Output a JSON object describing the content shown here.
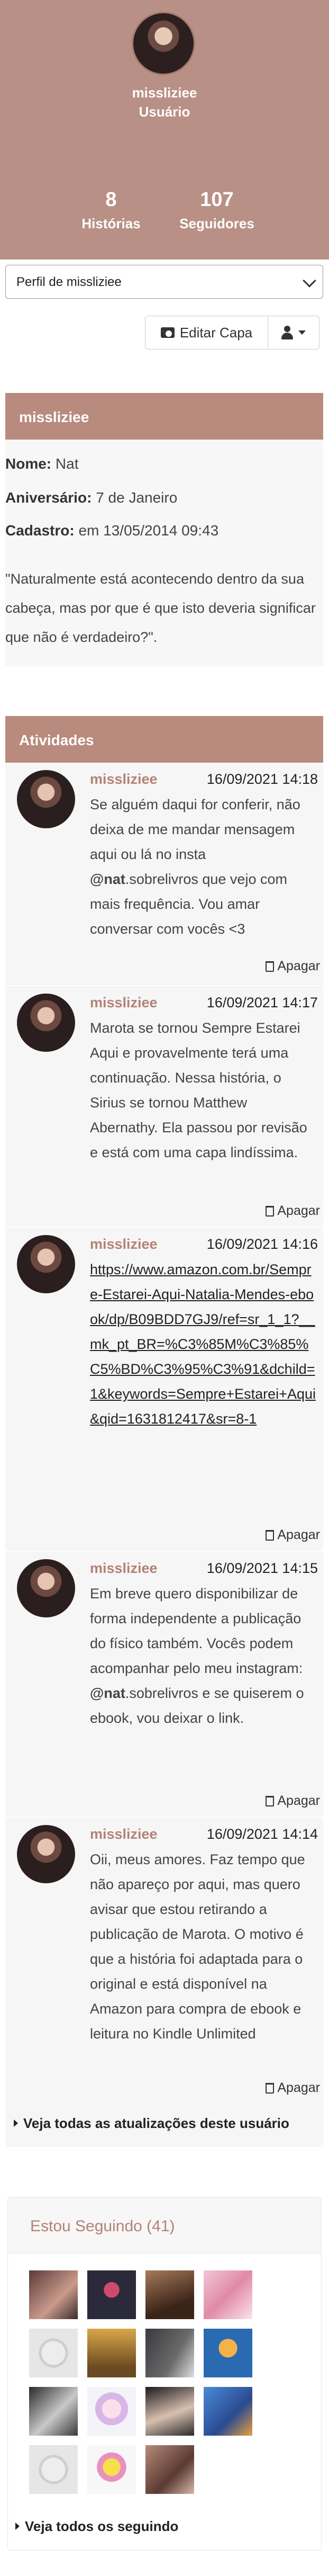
{
  "profile": {
    "username": "missliziee",
    "role": "Usuário",
    "stats": [
      {
        "value": "8",
        "label": "Histórias"
      },
      {
        "value": "107",
        "label": "Seguidores"
      }
    ],
    "profile_select": "Perfil de missliziee",
    "edit_cover": "Editar Capa"
  },
  "about": {
    "title": "missliziee",
    "name_label": "Nome:",
    "name_value": "Nat",
    "birthday_label": "Aniversário:",
    "birthday_value": "7 de Janeiro",
    "signup_label": "Cadastro:",
    "signup_value": "em 13/05/2014 09:43",
    "bio": "\"Naturalmente está acontecendo dentro da sua cabeça, mas por que é que isto deveria significar que não é verdadeiro?\"."
  },
  "activities": {
    "title": "Atividades",
    "delete_label": "Apagar",
    "items": [
      {
        "user": "missliziee",
        "time": "16/09/2021 14:18",
        "pre": "Se alguém daqui for conferir, não deixa de me mandar mensagem aqui ou lá no insta ",
        "mention": "@nat",
        "post": ".sobrelivros que vejo com mais frequência. Vou amar conversar com vocês <3"
      },
      {
        "user": "missliziee",
        "time": "16/09/2021 14:17",
        "text": "Marota se tornou Sempre Estarei Aqui e provavelmente terá uma continuação. Nessa história, o Sirius se tornou Matthew Abernathy. Ela passou por revisão e está com uma capa lindíssima."
      },
      {
        "user": "missliziee",
        "time": "16/09/2021 14:16",
        "link": "https://www.amazon.com.br/Sempre-Estarei-Aqui-Natalia-Mendes-ebook/dp/B09BDD7GJ9/ref=sr_1_1?__mk_pt_BR=%C3%85M%C3%85%C5%BD%C3%95%C3%91&dchild=1&keywords=Sempre+Estarei+Aqui&qid=1631812417&sr=8-1"
      },
      {
        "user": "missliziee",
        "time": "16/09/2021 14:15",
        "pre": "Em breve quero disponibilizar de forma independente a publicação do físico também. Vocês podem acompanhar pelo meu instagram: ",
        "mention": "@nat",
        "post": ".sobrelivros e se quiserem o ebook, vou deixar o link."
      },
      {
        "user": "missliziee",
        "time": "16/09/2021 14:14",
        "text": "Oii, meus amores. Faz tempo que não apareço por aqui, mas quero avisar que estou retirando a publicação de Marota. O motivo é que a história foi adaptada para o original e está disponível na Amazon para compra de ebook e leitura no Kindle Unlimited"
      }
    ],
    "see_all": "Veja todas as atualizações deste usuário"
  },
  "following": {
    "title": "Estou Seguindo (41)",
    "see_all": "Veja todos os seguindo"
  },
  "colors": {
    "header_bg": "#b99085",
    "panel_head": "#b98a7e",
    "username_accent": "#b48276"
  }
}
